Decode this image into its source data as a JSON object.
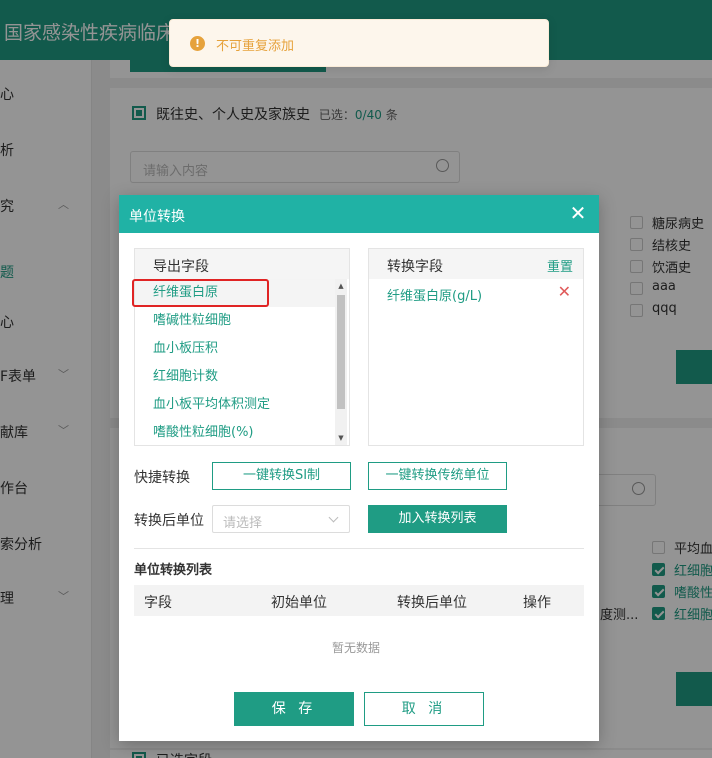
{
  "app": {
    "title": "国家感染性疾病临床"
  },
  "sidebar": {
    "items": [
      {
        "label": "心"
      },
      {
        "label": "析"
      },
      {
        "label": "究"
      },
      {
        "label": "题"
      },
      {
        "label": "心"
      },
      {
        "label": "F表单"
      },
      {
        "label": "献库"
      },
      {
        "label": "作台"
      },
      {
        "label": "索分析"
      },
      {
        "label": "理"
      }
    ]
  },
  "background": {
    "section_title": "既往史、个人史及家族史",
    "selected_prefix": "已选：",
    "selected_count": "0/40",
    "selected_unit": "条",
    "search_placeholder": "请输入内容",
    "history_items": [
      "糖尿病史",
      "结核史",
      "饮酒史",
      "aaa",
      "qqq"
    ],
    "lab_items": [
      {
        "label": "平均血",
        "checked": false
      },
      {
        "label": "红细胞",
        "checked": true
      },
      {
        "label": "嗜酸性",
        "checked": true
      },
      {
        "label": "红细胞",
        "checked": true
      }
    ],
    "truncated_text": "度测...",
    "bottom_title": "已选字段"
  },
  "toast": {
    "icon": "warning-icon",
    "text": "不可重复添加",
    "color": "#e6a23c"
  },
  "dialog": {
    "title": "单位转换",
    "export_panel": {
      "title": "导出字段",
      "items": [
        "纤维蛋白原",
        "嗜碱性粒细胞",
        "血小板压积",
        "红细胞计数",
        "血小板平均体积测定",
        "嗜酸性粒细胞(%)"
      ]
    },
    "convert_panel": {
      "title": "转换字段",
      "reset_label": "重置",
      "items": [
        "纤维蛋白原(g/L)"
      ]
    },
    "quick_label": "快捷转换",
    "quick_si_label": "一键转换SI制",
    "quick_trad_label": "一键转换传统单位",
    "unit_label": "转换后单位",
    "unit_placeholder": "请选择",
    "add_label": "加入转换列表",
    "list_title": "单位转换列表",
    "table_headers": [
      "字段",
      "初始单位",
      "转换后单位",
      "操作"
    ],
    "empty_text": "暂无数据",
    "save_label": "保 存",
    "cancel_label": "取 消"
  },
  "colors": {
    "primary": "#1f9c84",
    "dialog_header": "#20b2a5",
    "highlight": "#e02424"
  }
}
